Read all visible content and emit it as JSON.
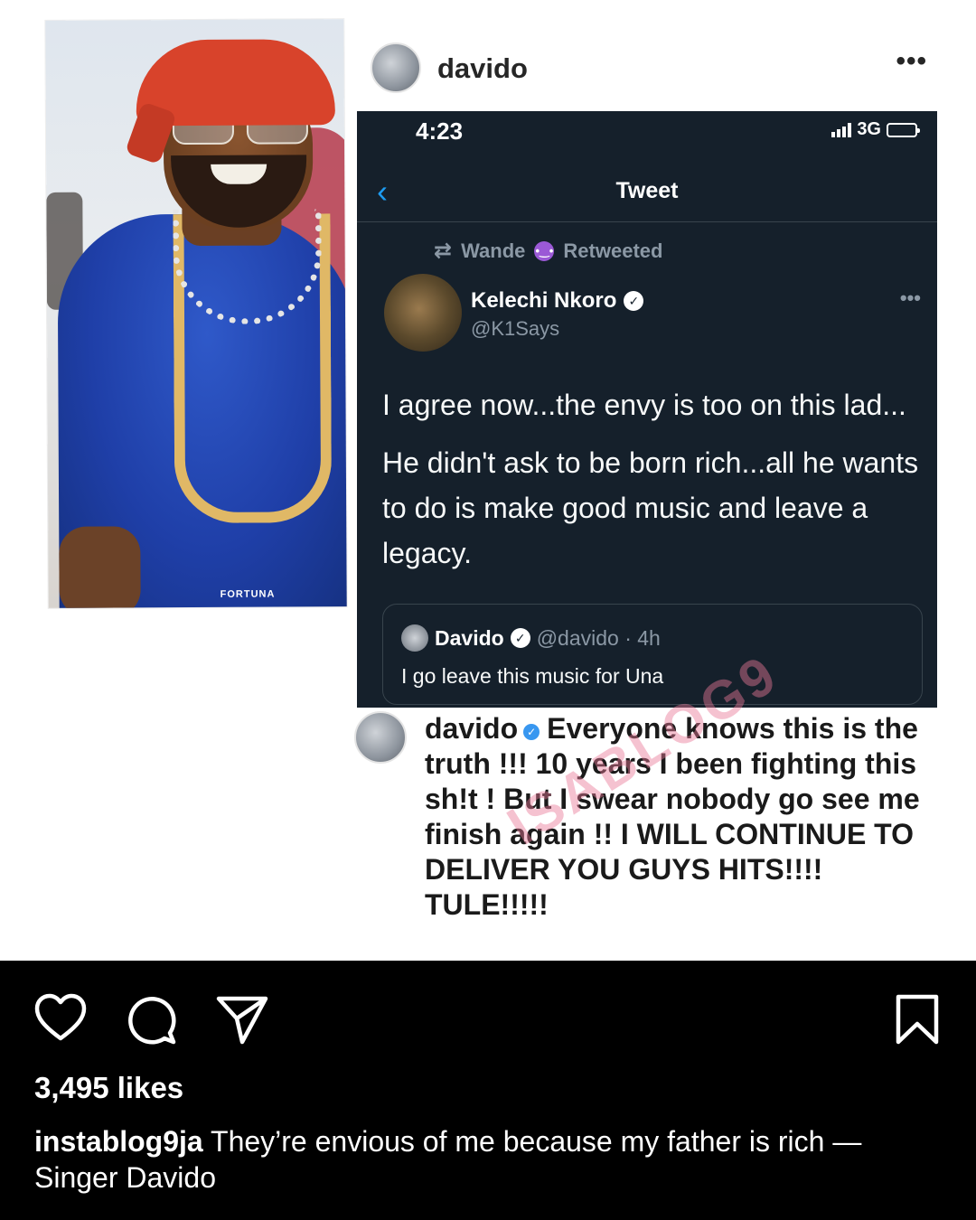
{
  "post_header": {
    "username": "davido",
    "more_glyph": "•••"
  },
  "photo": {
    "brand_mark": "FORTUNA"
  },
  "tweet_screenshot": {
    "status": {
      "time": "4:23",
      "network": "3G"
    },
    "nav": {
      "back_glyph": "‹",
      "title": "Tweet"
    },
    "retweet": {
      "by": "Wande",
      "emoji": "😈",
      "label": "Retweeted"
    },
    "author": {
      "name": "Kelechi Nkoro",
      "handle": "@K1Says",
      "more_glyph": "•••"
    },
    "text": [
      "I agree now...the envy is too on this lad...",
      "He didn't ask to be born rich...all he wants to do is make good music and leave a legacy."
    ],
    "quoted": {
      "name": "Davido",
      "meta": "@davido · 4h",
      "text": "I go leave this music for Una"
    }
  },
  "overlay_caption": {
    "username": "davido",
    "text": "Everyone knows this is the truth !!! 10 years I been fighting this sh!t !  But I swear nobody go see me finish again !! I WILL CONTINUE TO DELIVER YOU GUYS HITS!!!! TULE!!!!!",
    "watermark": "ISABLOG9"
  },
  "instagram_bar": {
    "icons": [
      "heart-icon",
      "comment-icon",
      "share-icon",
      "bookmark-icon"
    ],
    "likes": "3,495 likes",
    "caption_user": "instablog9ja",
    "caption_text": "They’re envious of me because my father is rich — Singer Davido"
  },
  "colors": {
    "tweet_bg": "#15202b",
    "twitter_blue": "#1d9bf0",
    "muted": "#8b98a5",
    "bar_bg": "#000000"
  }
}
